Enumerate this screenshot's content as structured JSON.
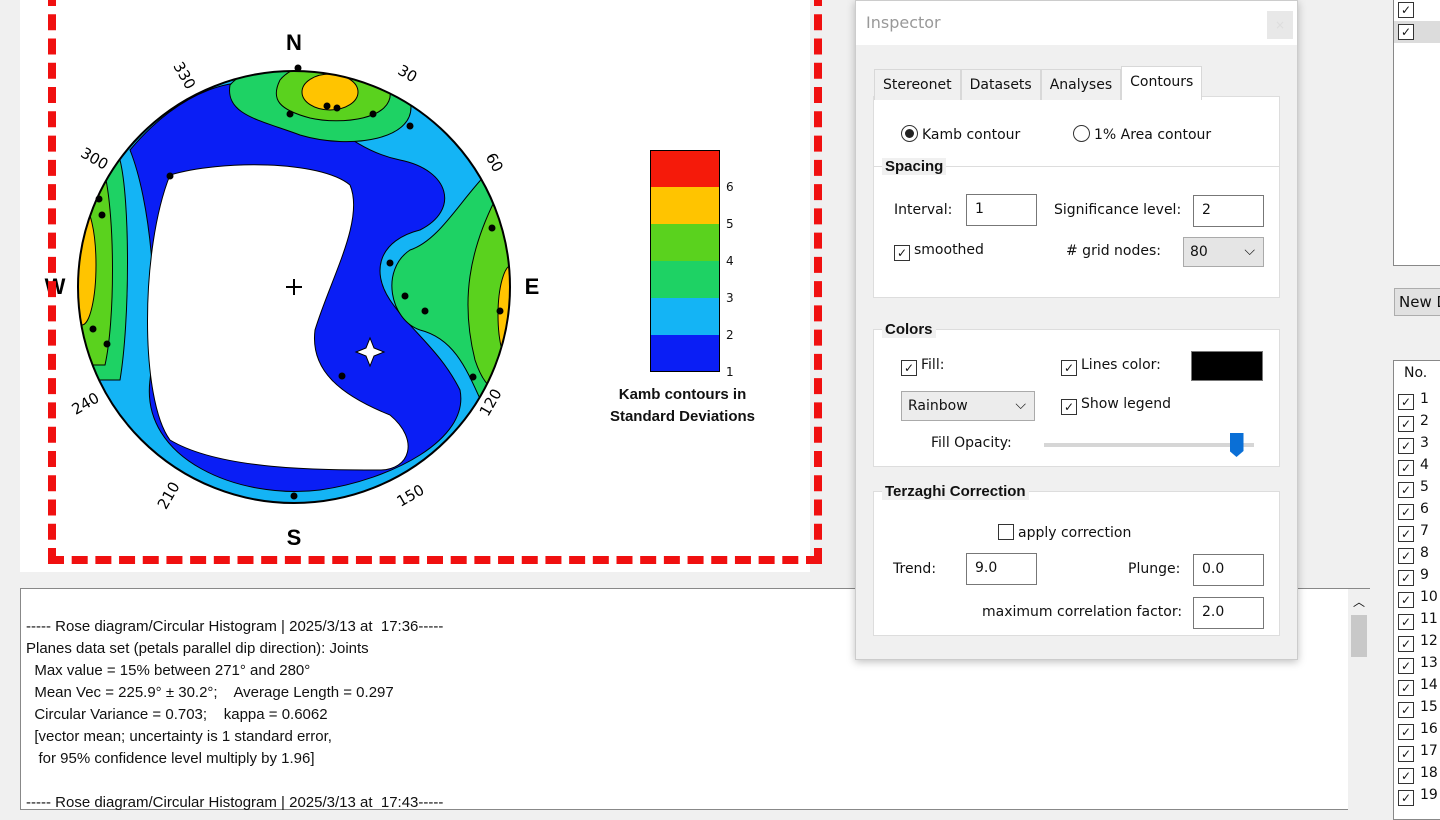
{
  "stereonet": {
    "north": "N",
    "south": "S",
    "east": "E",
    "west": "W",
    "degree_labels": [
      "30",
      "60",
      "120",
      "150",
      "210",
      "240",
      "300",
      "330"
    ]
  },
  "legend": {
    "title_line1": "Kamb contours in",
    "title_line2": "Standard Deviations",
    "ticks": [
      "6",
      "5",
      "4",
      "3",
      "2",
      "1"
    ],
    "colors": [
      "#f51a0a",
      "#ffc400",
      "#5ad21e",
      "#1ed264",
      "#14b4f5",
      "#0a1ef5"
    ]
  },
  "log": {
    "lines": [
      "----- Rose diagram/Circular Histogram | 2025/3/13 at  17:36-----",
      "Planes data set (petals parallel dip direction): Joints",
      "  Max value = 15% between 271° and 280°",
      "  Mean Vec = 225.9° ± 30.2°;    Average Length = 0.297",
      "  Circular Variance = 0.703;    kappa = 0.6062",
      "  [vector mean; uncertainty is 1 standard error,",
      "   for 95% confidence level multiply by 1.96]",
      "",
      "----- Rose diagram/Circular Histogram | 2025/3/13 at  17:43-----"
    ]
  },
  "inspector": {
    "title": "Inspector",
    "close": "×",
    "tabs": [
      "Stereonet",
      "Datasets",
      "Analyses",
      "Contours"
    ],
    "radio_kamb": "Kamb contour",
    "radio_area": "1% Area contour",
    "spacing": {
      "title": "Spacing",
      "interval_label": "Interval:",
      "interval": "1",
      "sig_label": "Significance level:",
      "sig": "2",
      "smoothed": "smoothed",
      "grid_label": "# grid nodes:",
      "grid": "80"
    },
    "colors": {
      "title": "Colors",
      "fill": "Fill:",
      "lines_color": "Lines color:",
      "line_color_value": "#000000",
      "palette": "Rainbow",
      "show_legend": "Show legend",
      "opacity_label": "Fill Opacity:",
      "opacity": 0.95
    },
    "terzaghi": {
      "title": "Terzaghi Correction",
      "apply": "apply correction",
      "trend_label": "Trend:",
      "trend": "9.0",
      "plunge_label": "Plunge:",
      "plunge": "0.0",
      "max_label": "maximum correlation factor:",
      "max": "2.0"
    }
  },
  "right": {
    "new_button": "New D",
    "col_no": "No.",
    "rows": [
      "1",
      "2",
      "3",
      "4",
      "5",
      "6",
      "7",
      "8",
      "9",
      "10",
      "11",
      "12",
      "13",
      "14",
      "15",
      "16",
      "17",
      "18",
      "19"
    ]
  }
}
